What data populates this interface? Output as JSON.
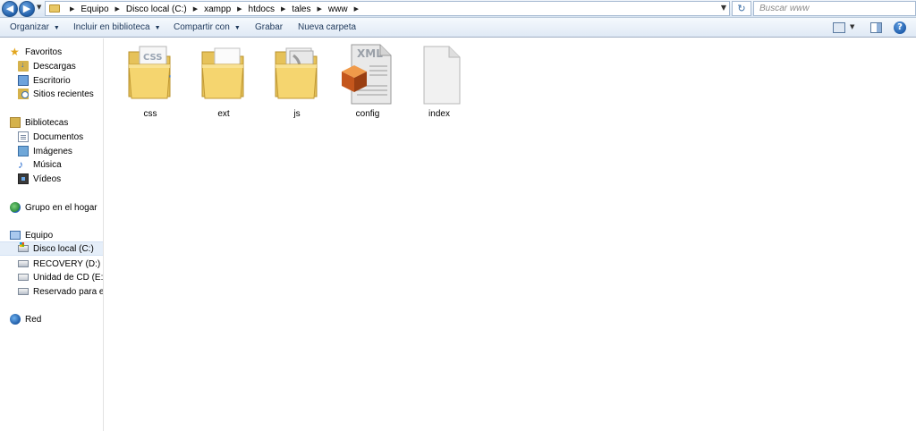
{
  "address_bar": {
    "breadcrumbs": [
      "Equipo",
      "Disco local (C:)",
      "xampp",
      "htdocs",
      "tales",
      "www"
    ],
    "search_placeholder": "Buscar www"
  },
  "command_bar": {
    "organize": "Organizar",
    "include_library": "Incluir en biblioteca",
    "share_with": "Compartir con",
    "burn": "Grabar",
    "new_folder": "Nueva carpeta"
  },
  "nav": {
    "favorites": "Favoritos",
    "favorites_items": [
      "Descargas",
      "Escritorio",
      "Sitios recientes"
    ],
    "libraries": "Bibliotecas",
    "libraries_items": [
      "Documentos",
      "Imágenes",
      "Música",
      "Vídeos"
    ],
    "homegroup": "Grupo en el hogar",
    "computer": "Equipo",
    "computer_items": [
      "Disco local (C:)",
      "RECOVERY (D:)",
      "Unidad de CD (E:)",
      "Reservado para el sis"
    ],
    "network": "Red"
  },
  "files": [
    {
      "name": "css",
      "kind": "folder",
      "overlay": "css-document"
    },
    {
      "name": "ext",
      "kind": "folder",
      "overlay": "blank-page"
    },
    {
      "name": "js",
      "kind": "folder",
      "overlay": "pages"
    },
    {
      "name": "config",
      "kind": "xml",
      "overlay_text": "XML"
    },
    {
      "name": "index",
      "kind": "file",
      "overlay": "blank"
    }
  ],
  "colors": {
    "folder_yellow": "#f0cf6b",
    "selection_bg": "#e5eef9",
    "accent_blue": "#1e5aa8"
  }
}
